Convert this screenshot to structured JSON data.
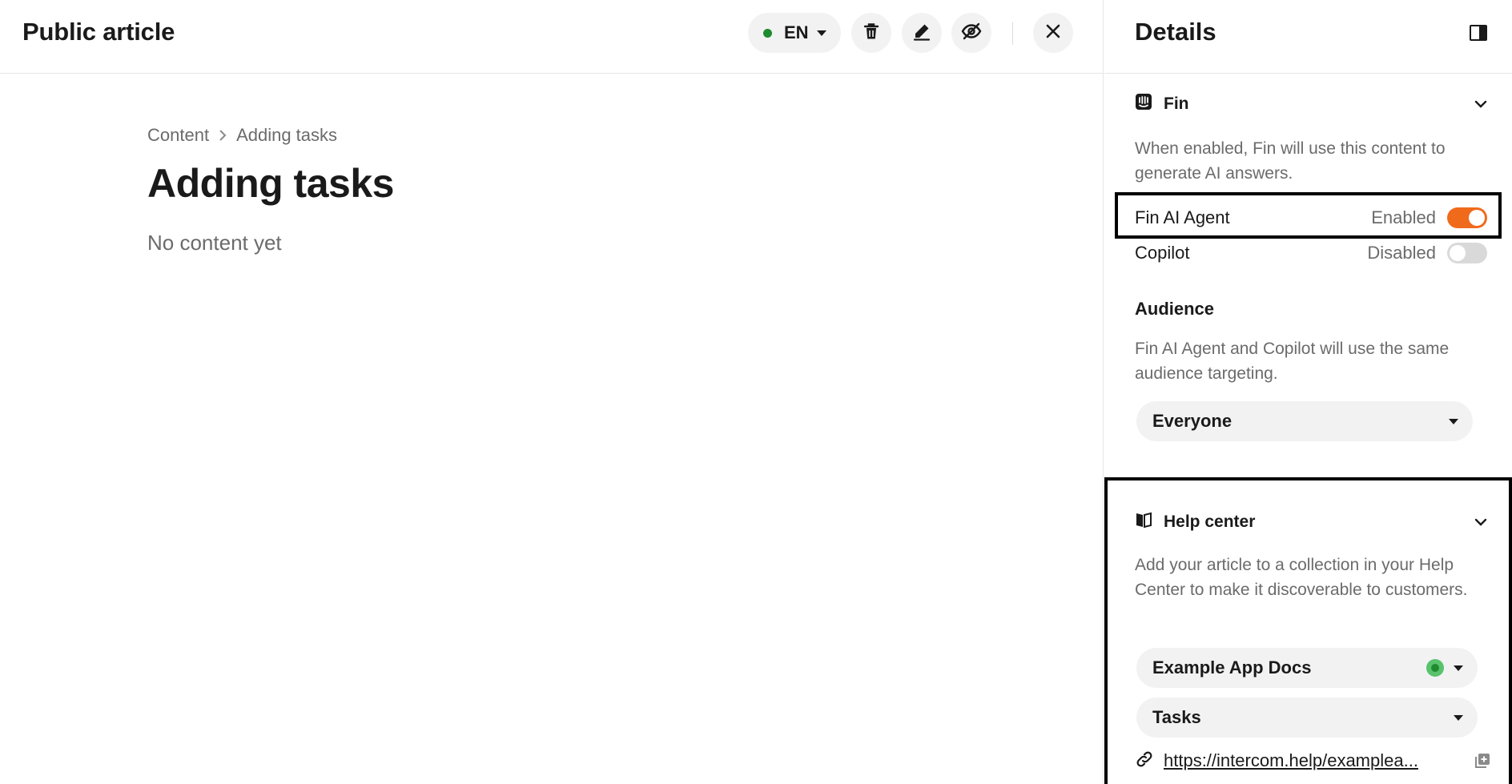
{
  "header": {
    "title": "Public article",
    "language": "EN",
    "language_status_color": "#1f8a2e",
    "icons": [
      "trash-icon",
      "pencil-icon",
      "eye-off-icon",
      "close-icon"
    ]
  },
  "article": {
    "breadcrumb": [
      "Content",
      "Adding tasks"
    ],
    "title": "Adding tasks",
    "empty_text": "No content yet"
  },
  "details": {
    "title": "Details",
    "fin": {
      "label": "Fin",
      "description": "When enabled, Fin will use this content to generate AI answers.",
      "toggles": [
        {
          "name": "Fin AI Agent",
          "state": "Enabled",
          "on": true
        },
        {
          "name": "Copilot",
          "state": "Disabled",
          "on": false
        }
      ],
      "audience": {
        "label": "Audience",
        "description": "Fin AI Agent and Copilot will use the same audience targeting.",
        "value": "Everyone"
      }
    },
    "help_center": {
      "label": "Help center",
      "description": "Add your article to a collection in your Help Center to make it discoverable to customers.",
      "help_center_value": "Example App Docs",
      "collection_value": "Tasks",
      "url": "https://intercom.help/examplea..."
    },
    "accent_color": "#f06a1c"
  }
}
